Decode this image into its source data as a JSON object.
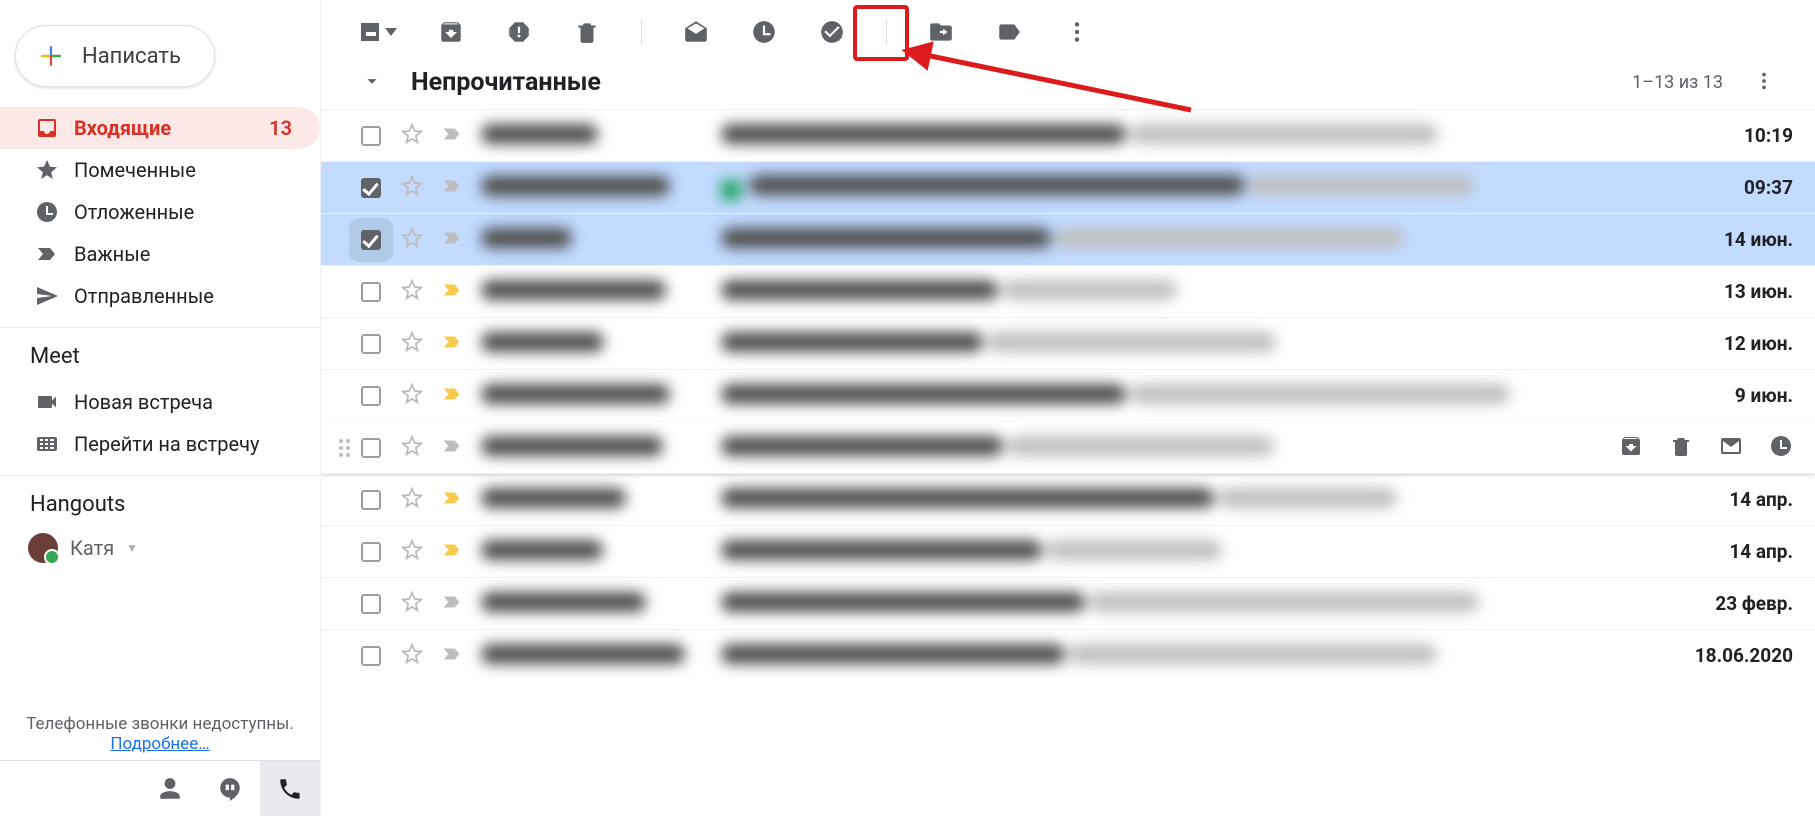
{
  "compose_label": "Написать",
  "sidebar": {
    "items": [
      {
        "label": "Входящие",
        "badge": "13",
        "active": true
      },
      {
        "label": "Помеченные"
      },
      {
        "label": "Отложенные"
      },
      {
        "label": "Важные"
      },
      {
        "label": "Отправленные"
      }
    ]
  },
  "meet": {
    "title": "Meet",
    "new": "Новая встреча",
    "join": "Перейти на встречу"
  },
  "hangouts": {
    "title": "Hangouts",
    "user": "Катя"
  },
  "footer": {
    "line1": "Телефонные звонки недоступны.",
    "more": "Подробнее…"
  },
  "section": {
    "title": "Непрочитанные",
    "range": "1–13 из 13"
  },
  "emails": [
    {
      "time": "10:19",
      "important": false
    },
    {
      "time": "09:37",
      "important": false,
      "selected": true,
      "green": true
    },
    {
      "time": "14 июн.",
      "important": false,
      "selected": true,
      "checked_focus": true
    },
    {
      "time": "13 июн.",
      "important": true
    },
    {
      "time": "12 июн.",
      "important": true
    },
    {
      "time": "9 июн.",
      "important": true
    },
    {
      "time": "",
      "important": false,
      "hover": true
    },
    {
      "time": "14 апр.",
      "important": true
    },
    {
      "time": "14 апр.",
      "important": true
    },
    {
      "time": "23 февр.",
      "important": false
    },
    {
      "time": "18.06.2020",
      "important": false
    }
  ]
}
